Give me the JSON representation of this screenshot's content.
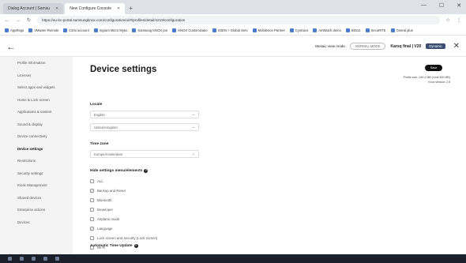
{
  "browser": {
    "tabs": [
      {
        "label": "Dialog Account | Samsu",
        "active": false
      },
      {
        "label": "New Configure Console",
        "active": true
      }
    ],
    "url": "https://eu-kc-portal.samsungknox.com/configuration/ui/#/profiles/detail/4219/configuration",
    "bookmarks": [
      "AppRegs",
      "VMware Remote",
      "Citrix account",
      "Ingram Micro Myko",
      "Samsung KNOX por",
      "KNOX Customizatio",
      "SSEN > Global Serv",
      "Mobileiron Partner",
      "Cyntracs",
      "AirWatch demo",
      "84512",
      "SecuRITE",
      "Overal plus"
    ]
  },
  "header": {
    "mode": "Mosaic view mode",
    "badge": "NORMAL MODE",
    "profile_name": "Karsq final | V20",
    "dynamic": "Dynamic"
  },
  "sidebar": {
    "items": [
      {
        "label": "Profile information",
        "active": false
      },
      {
        "label": "Licenses",
        "active": false
      },
      {
        "label": "Select apps and widgets",
        "active": false
      },
      {
        "label": "Home & Lock screen",
        "active": false
      },
      {
        "label": "Applications & content",
        "active": false
      },
      {
        "label": "Sound & display",
        "active": false
      },
      {
        "label": "Device connectivity",
        "active": false
      },
      {
        "label": "Device settings",
        "active": true
      },
      {
        "label": "Restrictions",
        "active": false
      },
      {
        "label": "Security settings",
        "active": false
      },
      {
        "label": "Kiosk Management",
        "active": false
      },
      {
        "label": "Shared devices",
        "active": false
      },
      {
        "label": "Enterprise actions",
        "active": false
      },
      {
        "label": "Devices",
        "active": false
      }
    ]
  },
  "main": {
    "title": "Device settings",
    "save": "Save",
    "profile_size": "Profile size: 240.4 MB (Limit 500 MB)",
    "knox_version": "Knox version: 2.8",
    "locale_label": "Locale",
    "locale_language": "English",
    "locale_region": "United Kingdom",
    "timezone_label": "Time zone",
    "timezone_value": "Europe/Amsterdam",
    "hide_label": "Hide settings menu/elements",
    "hide_items": [
      {
        "label": "ALL",
        "checked": false
      },
      {
        "label": "Backup and Reset",
        "checked": true
      },
      {
        "label": "Bluetooth",
        "checked": false
      },
      {
        "label": "Developer",
        "checked": false
      },
      {
        "label": "Airplane mode",
        "checked": false
      },
      {
        "label": "Language",
        "checked": true
      },
      {
        "label": "Lock screen and security (Lock screen)",
        "checked": false
      },
      {
        "label": "Wi-Fi",
        "checked": false
      }
    ],
    "auto_time_label": "Automatic Time Update"
  }
}
